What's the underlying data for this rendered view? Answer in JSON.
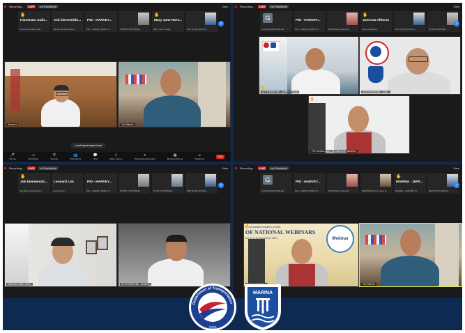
{
  "q1": {
    "recording": "Recording...",
    "live": "LIVE",
    "facebook": "on Facebook",
    "view": "View",
    "tiles": [
      {
        "name": "Kiavenaw Judit...",
        "sub": "Kiavenaw Judith Jandi..."
      },
      {
        "name": "Job bienvenido...",
        "sub": "Job Bienvenido Espano"
      },
      {
        "name": "PID - HARVEY...",
        "sub": "PID - HARVEY MARIC S..."
      },
      {
        "name": "",
        "sub": "POMDI CAPTIVENIE..."
      },
      {
        "name": "Mary June Nore...",
        "sub": "Mary June Noralla"
      },
      {
        "name": "",
        "sub": "MRT ROOF ARLING..."
      }
    ],
    "videos": [
      {
        "name": "Samansa"
      },
      {
        "name": "Tom Marbos"
      }
    ],
    "toast": "1 participant raised hand",
    "toolbar": [
      {
        "icon": "mic",
        "label": "Unmute"
      },
      {
        "icon": "camera",
        "label": "Start Video"
      },
      {
        "icon": "shield",
        "label": "Security"
      },
      {
        "icon": "people",
        "label": "Participants"
      },
      {
        "icon": "chat",
        "label": "Chat"
      },
      {
        "icon": "share",
        "label": "Share Screen"
      },
      {
        "icon": "record",
        "label": "Pause/Stop Recording"
      },
      {
        "icon": "rooms",
        "label": "Breakout Rooms"
      },
      {
        "icon": "reactions",
        "label": "Reactions"
      }
    ],
    "end": "End"
  },
  "q2": {
    "recording": "Recording...",
    "live": "LIVE",
    "facebook": "on Facebook",
    "view": "View",
    "tiles": [
      {
        "initial": "G",
        "name": "",
        "sub": "LOUIJE MARJORIE DE..."
      },
      {
        "name": "PID - HARVEY...",
        "sub": "PID - HARVEY MARIC S..."
      },
      {
        "name": "",
        "sub": "MARITIME CHALLEN..."
      },
      {
        "name": "Vanessa Alfonso",
        "sub": "Vanessa Alfonso"
      },
      {
        "name": "",
        "sub": "MRT ROOF ARLING..."
      },
      {
        "name": "",
        "sub": "DOTR MARITIME..."
      }
    ],
    "videos": [
      {
        "name": "DOTR MARITIME - ADMIN OFFICE"
      },
      {
        "name": "DOTR MARITIME - COM..."
      },
      {
        "name": "PID Central Luzon - CD Ramon M. Marcelino"
      }
    ]
  },
  "q3": {
    "recording": "Recording...",
    "live": "LIVE",
    "facebook": "on Facebook",
    "view": "View",
    "tiles": [
      {
        "name": "Job bienvenido...",
        "sub": "Job Bienvenido Espano"
      },
      {
        "name": "Leonard Lim",
        "sub": "Leonard Lim"
      },
      {
        "name": "PID - HARVEY...",
        "sub": "PID - HARVEY MARIC S..."
      },
      {
        "name": "",
        "sub": "POMDI CAPTIVENIE..."
      },
      {
        "name": "",
        "sub": "DOTR CAPTIVENIE..."
      },
      {
        "name": "",
        "sub": "MRT ROOF ARLING..."
      }
    ],
    "videos": [
      {
        "name": "Kiavenaw Judith Jandi..."
      },
      {
        "name": "DOTR MARITIME - ADMIN..."
      }
    ]
  },
  "q4": {
    "recording": "Recording...",
    "live": "LIVE",
    "facebook": "on Facebook",
    "view": "View",
    "tiles": [
      {
        "initial": "G",
        "name": "",
        "sub": "LOUIJE MARJORIE DE..."
      },
      {
        "name": "PID - HARVEY...",
        "sub": "PID - HARVEY MARIC S..."
      },
      {
        "name": "",
        "sub": "MARITIME CHALLEN..."
      },
      {
        "name": "",
        "sub": "MARITIME Cherry Rose N..."
      },
      {
        "name": "MARINA - JEFF...",
        "sub": "MARINA - JEFFREY M..."
      },
      {
        "name": "",
        "sub": "MRT ROOF ARLING..."
      }
    ],
    "banner_line1": "tion of Maritime Industries (TOMI)",
    "banner_line2": "OF NATIONAL WEBINARS",
    "banner_line3": "ber 21 & 28 September 2021",
    "webinar_badge": "Webinar",
    "videos": [
      {
        "name": "DOTR MARITIME..."
      },
      {
        "name": "Tom Marbos"
      }
    ]
  },
  "logos": {
    "dotr_ring": "Department of Transportation",
    "dotr_year": "1899",
    "marina_word": "MARINA"
  },
  "colors": {
    "frame": "#0f2a52",
    "zoom_dark": "#1a1a1a",
    "live_red": "#e02020",
    "raise_hand": "#f5c518",
    "zoom_blue": "#2d8cff"
  }
}
